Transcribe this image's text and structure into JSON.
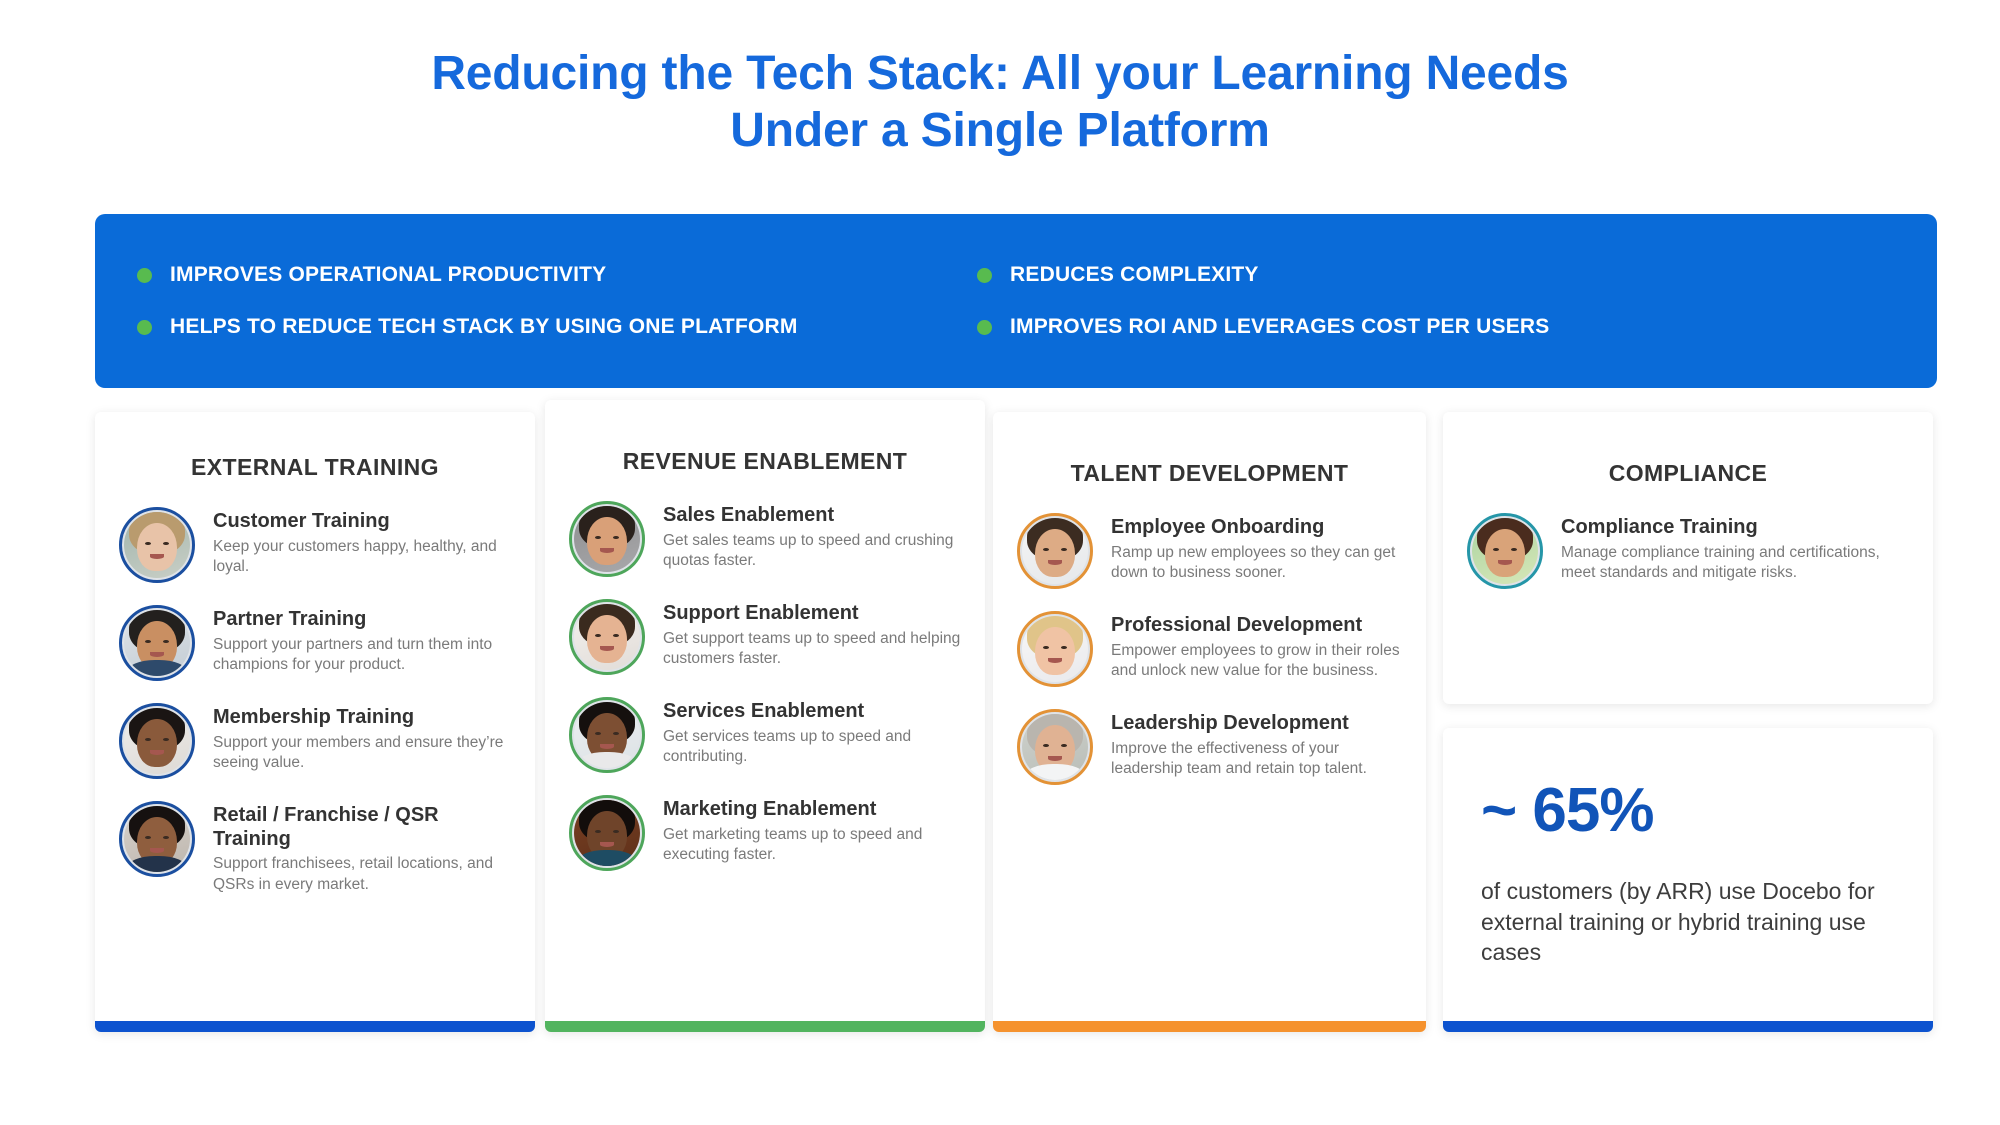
{
  "title": {
    "line1": "Reducing the Tech Stack: All your Learning Needs",
    "line2": "Under a Single Platform",
    "color": "#1569dc"
  },
  "banner": {
    "background": "#0a6bd8",
    "bullet_color": "#58bb4f",
    "left_items": [
      "IMPROVES OPERATIONAL PRODUCTIVITY",
      "HELPS TO REDUCE TECH STACK BY USING ONE PLATFORM"
    ],
    "right_items": [
      "REDUCES COMPLEXITY",
      "IMPROVES ROI AND LEVERAGES COST PER USERS"
    ]
  },
  "columns": [
    {
      "title": "EXTERNAL TRAINING",
      "accent": "#0d53cf",
      "ring": "#1b4fa0",
      "items": [
        {
          "title": "Customer Training",
          "desc": "Keep your customers happy, healthy, and loyal."
        },
        {
          "title": "Partner Training",
          "desc": "Support your partners and turn them into champions for your product."
        },
        {
          "title": "Membership Training",
          "desc": "Support your members and ensure they’re seeing value."
        },
        {
          "title": "Retail / Franchise / QSR Training",
          "desc": "Support franchisees, retail locations, and QSRs in every market."
        }
      ]
    },
    {
      "title": "REVENUE ENABLEMENT",
      "accent": "#52b45f",
      "ring": "#4ea65b",
      "items": [
        {
          "title": "Sales Enablement",
          "desc": "Get sales teams up to speed and crushing quotas faster."
        },
        {
          "title": "Support Enablement",
          "desc": "Get support teams up to speed and helping customers faster."
        },
        {
          "title": "Services Enablement",
          "desc": "Get services teams up to speed and contributing."
        },
        {
          "title": "Marketing Enablement",
          "desc": "Get marketing teams up to speed and executing faster."
        }
      ]
    },
    {
      "title": "TALENT DEVELOPMENT",
      "accent": "#f5922e",
      "ring": "#e39236",
      "items": [
        {
          "title": "Employee Onboarding",
          "desc": "Ramp up new employees so they can get down to business sooner."
        },
        {
          "title": "Professional Development",
          "desc": "Empower employees to grow in their roles and unlock new value for the business."
        },
        {
          "title": "Leadership Development",
          "desc": "Improve the effectiveness of your leadership team and retain top talent."
        }
      ]
    },
    {
      "title": "COMPLIANCE",
      "accent": "#0d53cf",
      "ring": "#2596a8",
      "items": [
        {
          "title": "Compliance Training",
          "desc": "Manage compliance training and certifications, meet standards and mitigate risks."
        }
      ]
    }
  ],
  "stat": {
    "number": "~ 65%",
    "caption": "of customers (by ARR) use Docebo for external training or hybrid training use cases",
    "accent": "#0d53cf",
    "number_color": "#1154b8"
  }
}
